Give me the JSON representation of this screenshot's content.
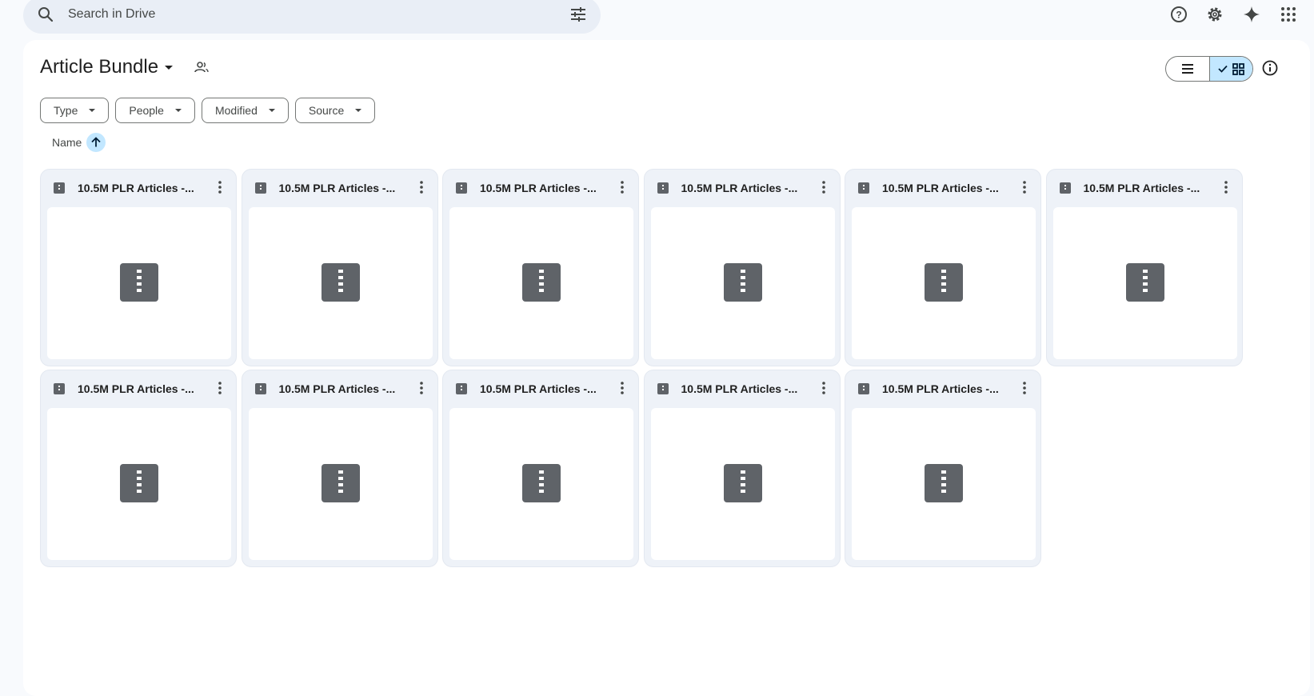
{
  "search": {
    "placeholder": "Search in Drive",
    "icon": "search-icon",
    "filter_icon": "tune-icon"
  },
  "topbar_icons": [
    "help-icon",
    "settings-icon",
    "gemini-sparkle-icon",
    "apps-grid-icon"
  ],
  "folder": {
    "title": "Article Bundle",
    "shared_icon": "shared-folder-icon"
  },
  "view_toggle": {
    "list_icon": "list-view-icon",
    "grid_icon": "grid-view-icon",
    "active": "grid"
  },
  "info_icon": "info-icon",
  "filters": [
    {
      "label": "Type"
    },
    {
      "label": "People"
    },
    {
      "label": "Modified"
    },
    {
      "label": "Source"
    }
  ],
  "sort": {
    "label": "Name",
    "direction": "ascending"
  },
  "files": [
    {
      "name": "10.5M PLR Articles -...",
      "type": "zip"
    },
    {
      "name": "10.5M PLR Articles -...",
      "type": "zip"
    },
    {
      "name": "10.5M PLR Articles -...",
      "type": "zip"
    },
    {
      "name": "10.5M PLR Articles -...",
      "type": "zip"
    },
    {
      "name": "10.5M PLR Articles -...",
      "type": "zip"
    },
    {
      "name": "10.5M PLR Articles -...",
      "type": "zip"
    },
    {
      "name": "10.5M PLR Articles -...",
      "type": "zip"
    },
    {
      "name": "10.5M PLR Articles -...",
      "type": "zip"
    },
    {
      "name": "10.5M PLR Articles -...",
      "type": "zip"
    },
    {
      "name": "10.5M PLR Articles -...",
      "type": "zip"
    },
    {
      "name": "10.5M PLR Articles -...",
      "type": "zip"
    }
  ],
  "colors": {
    "accent": "#c2e7ff",
    "background": "#f8fafd",
    "search_bg": "#e9eef6",
    "icon_gray": "#5f6368"
  }
}
